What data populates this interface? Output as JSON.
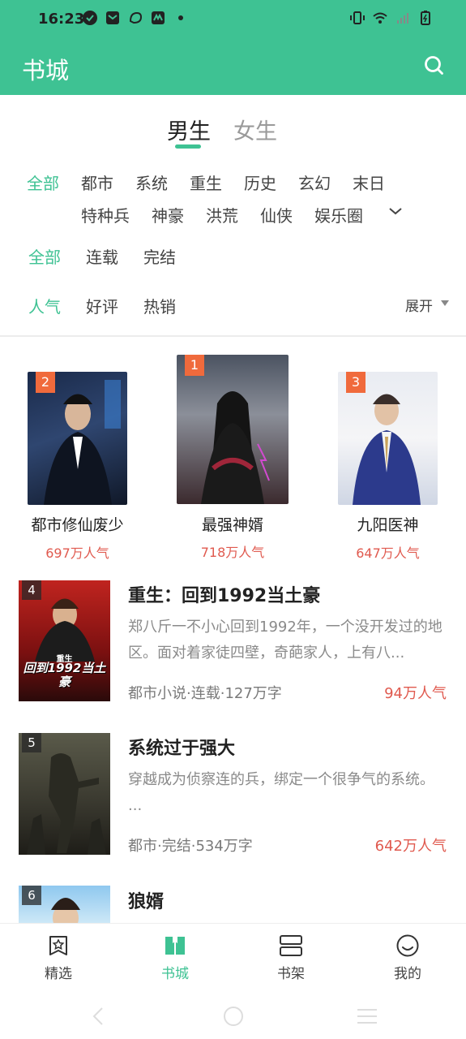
{
  "status": {
    "time": "16:23"
  },
  "header": {
    "title": "书城",
    "accent": "#3ec293"
  },
  "gender_tabs": [
    "男生",
    "女生"
  ],
  "categories": [
    "全部",
    "都市",
    "系统",
    "重生",
    "历史",
    "玄幻",
    "末日",
    "特种兵",
    "神豪",
    "洪荒",
    "仙侠",
    "娱乐圈"
  ],
  "status_filters": [
    "全部",
    "连载",
    "完结"
  ],
  "sort_filters": [
    "人气",
    "好评",
    "热销"
  ],
  "expand_label": "展开",
  "top3": [
    {
      "rank": "2",
      "title": "都市修仙废少",
      "popularity": "697万人气",
      "badge_color": "#f06a3c"
    },
    {
      "rank": "1",
      "title": "最强神婿",
      "popularity": "718万人气",
      "badge_color": "#f06a3c"
    },
    {
      "rank": "3",
      "title": "九阳医神",
      "popularity": "647万人气",
      "badge_color": "#f06a3c"
    }
  ],
  "books": [
    {
      "rank": "4",
      "title": "重生：回到1992当土豪",
      "desc": "郑八斤一不小心回到1992年，一个没开发过的地区。面对着家徒四壁，奇葩家人，上有八...",
      "meta": "都市小说·连载·127万字",
      "popularity": "94万人气",
      "cover_text": "回到1992当土豪",
      "cover_tag": "重生"
    },
    {
      "rank": "5",
      "title": "系统过于强大",
      "desc": "穿越成为侦察连的兵，绑定一个很争气的系统。 ...",
      "meta": "都市·完结·534万字",
      "popularity": "642万人气"
    },
    {
      "rank": "6",
      "title": "狼婿"
    }
  ],
  "bottom_nav": [
    {
      "label": "精选",
      "icon": "star-book-icon"
    },
    {
      "label": "书城",
      "icon": "bookstore-icon"
    },
    {
      "label": "书架",
      "icon": "bookshelf-icon"
    },
    {
      "label": "我的",
      "icon": "profile-smile-icon"
    }
  ]
}
